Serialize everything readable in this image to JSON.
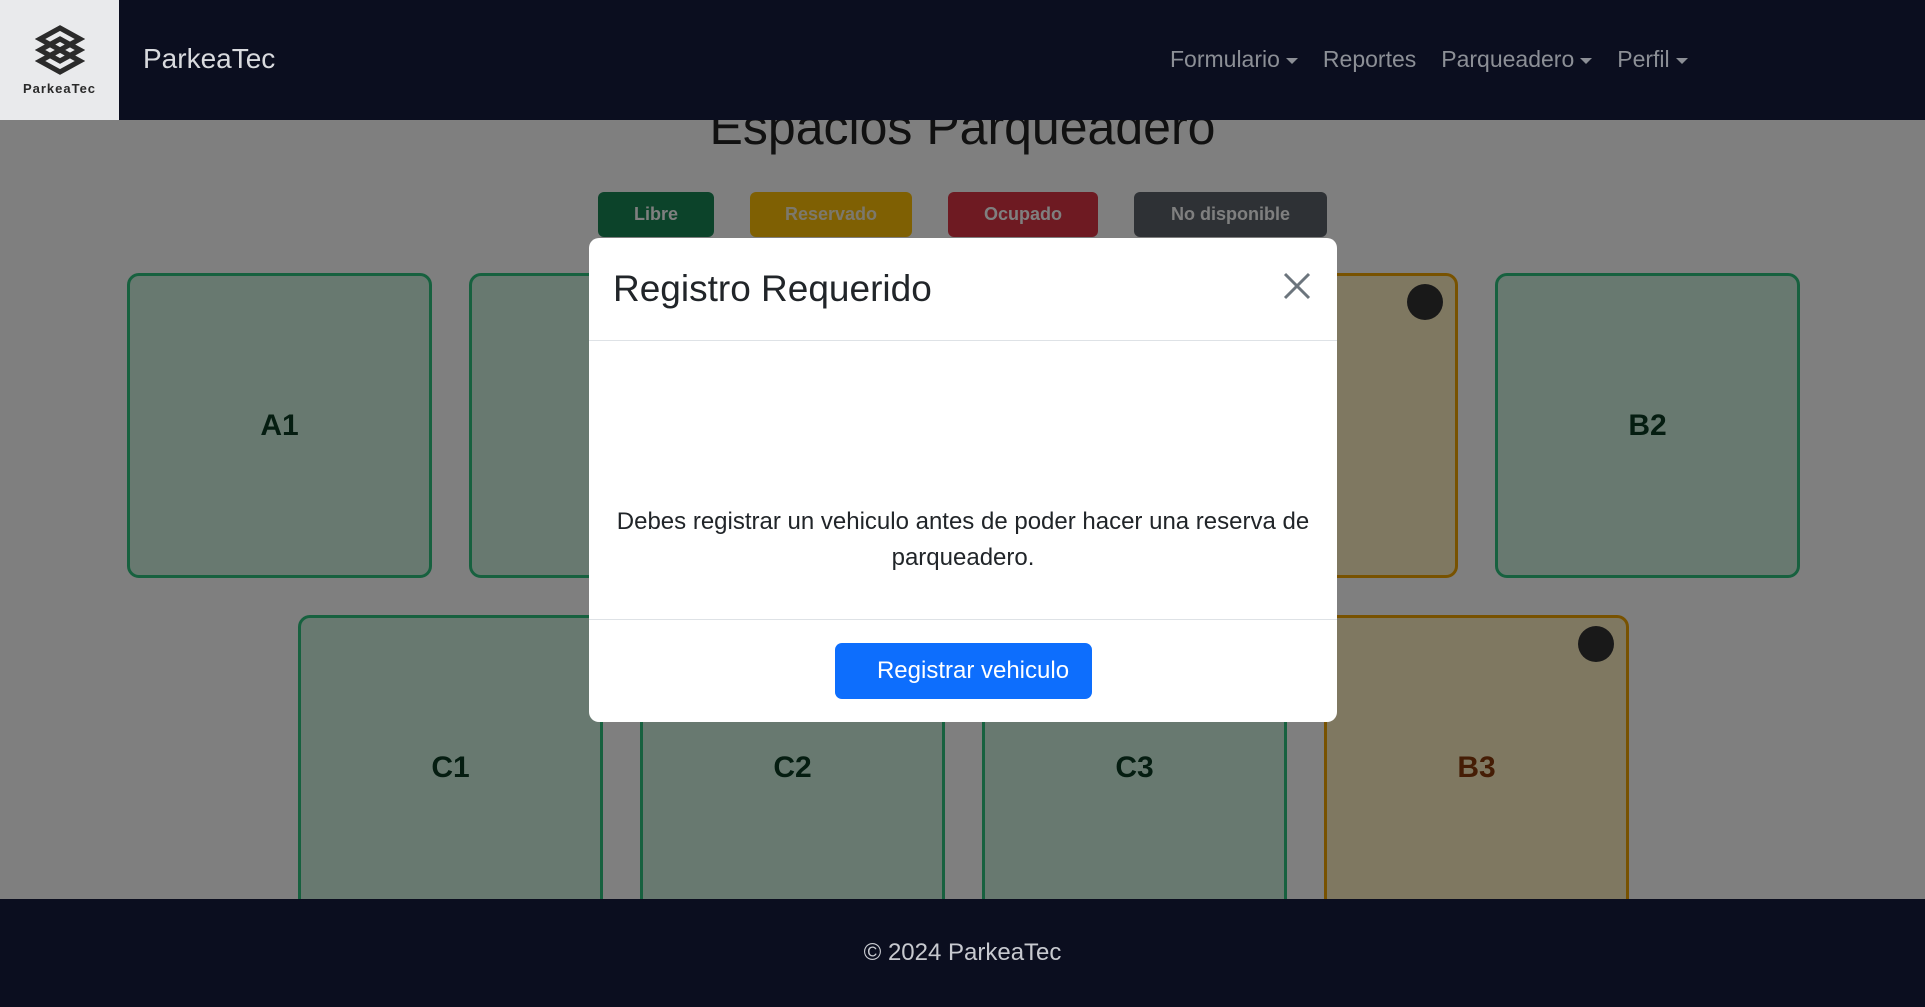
{
  "navbar": {
    "logo_text": "ParkeaTec",
    "brand": "ParkeaTec",
    "links": [
      {
        "label": "Formulario",
        "dropdown": true
      },
      {
        "label": "Reportes",
        "dropdown": false
      },
      {
        "label": "Parqueadero",
        "dropdown": true
      },
      {
        "label": "Perfil",
        "dropdown": true
      }
    ]
  },
  "page": {
    "title": "Espacios Parqueadero",
    "legend": {
      "libre": "Libre",
      "reservado": "Reservado",
      "ocupado": "Ocupado",
      "no_disponible": "No disponible"
    },
    "spots": [
      {
        "label": "A1",
        "status": "libre"
      },
      {
        "label": "",
        "status": "libre"
      },
      {
        "label": "",
        "status": "reservado"
      },
      {
        "label": "B2",
        "status": "libre"
      },
      {
        "label": "C1",
        "status": "libre"
      },
      {
        "label": "C2",
        "status": "libre"
      },
      {
        "label": "C3",
        "status": "libre"
      },
      {
        "label": "B3",
        "status": "reservado"
      }
    ]
  },
  "modal": {
    "title": "Registro Requerido",
    "message": "Debes registrar un vehiculo antes de poder hacer una reserva de parqueadero.",
    "primary_button": "Registrar vehiculo"
  },
  "footer": {
    "copyright": "© 2024 ParkeaTec"
  },
  "colors": {
    "navbar_bg": "#0b0e1f",
    "libre": "#198754",
    "reservado": "#ffc107",
    "ocupado": "#dc3545",
    "no_disponible": "#5c636a",
    "primary": "#0d6efd"
  }
}
